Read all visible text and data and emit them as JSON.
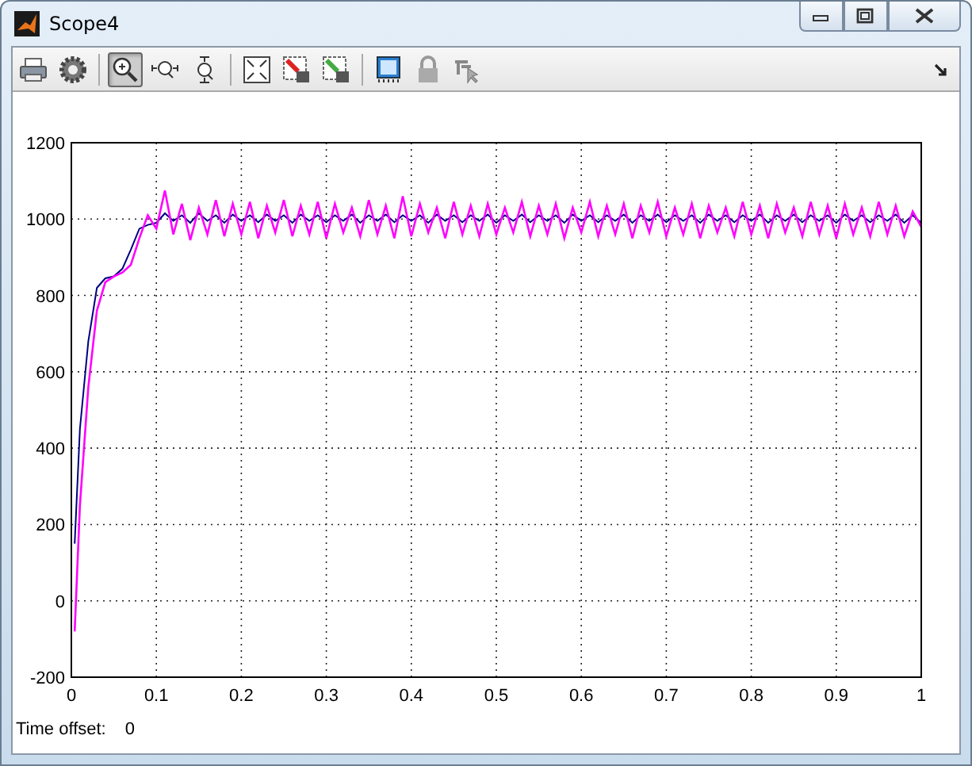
{
  "window": {
    "title": "Scope4"
  },
  "toolbar": [
    {
      "kind": "print",
      "selected": false
    },
    {
      "kind": "parameters",
      "selected": false
    },
    {
      "kind": "separator"
    },
    {
      "kind": "zoom",
      "selected": true
    },
    {
      "kind": "zoom-x",
      "selected": false
    },
    {
      "kind": "zoom-y",
      "selected": false
    },
    {
      "kind": "separator"
    },
    {
      "kind": "autoscale",
      "selected": false
    },
    {
      "kind": "save-axes",
      "selected": false
    },
    {
      "kind": "restore-axes",
      "selected": false
    },
    {
      "kind": "separator"
    },
    {
      "kind": "float",
      "selected": false
    },
    {
      "kind": "lock",
      "selected": false
    },
    {
      "kind": "signal-select",
      "selected": false
    }
  ],
  "plot": {
    "chart_data": {
      "type": "line",
      "grid": true,
      "x": [
        0.004,
        0.01,
        0.02,
        0.03,
        0.04,
        0.05,
        0.06,
        0.07,
        0.08,
        0.09,
        0.1,
        0.11,
        0.12,
        0.13,
        0.14,
        0.15,
        0.16,
        0.17,
        0.18,
        0.19,
        0.2,
        0.21,
        0.22,
        0.23,
        0.24,
        0.25,
        0.26,
        0.27,
        0.28,
        0.29,
        0.3,
        0.31,
        0.32,
        0.33,
        0.34,
        0.35,
        0.36,
        0.37,
        0.38,
        0.39,
        0.4,
        0.41,
        0.42,
        0.43,
        0.44,
        0.45,
        0.46,
        0.47,
        0.48,
        0.49,
        0.5,
        0.51,
        0.52,
        0.53,
        0.54,
        0.55,
        0.56,
        0.57,
        0.58,
        0.59,
        0.6,
        0.61,
        0.62,
        0.63,
        0.64,
        0.65,
        0.66,
        0.67,
        0.68,
        0.69,
        0.7,
        0.71,
        0.72,
        0.73,
        0.74,
        0.75,
        0.76,
        0.77,
        0.78,
        0.79,
        0.8,
        0.81,
        0.82,
        0.83,
        0.84,
        0.85,
        0.86,
        0.87,
        0.88,
        0.89,
        0.9,
        0.91,
        0.92,
        0.93,
        0.94,
        0.95,
        0.96,
        0.97,
        0.98,
        0.99,
        1
      ],
      "series": [
        {
          "color": "#000080",
          "values": [
            150,
            450,
            680,
            820,
            845,
            850,
            870,
            920,
            975,
            985,
            990,
            1015,
            995,
            1010,
            990,
            1015,
            995,
            1010,
            990,
            1012,
            995,
            1010,
            992,
            1012,
            995,
            1010,
            990,
            1012,
            995,
            1010,
            992,
            1010,
            995,
            1012,
            990,
            1010,
            995,
            1012,
            992,
            1010,
            995,
            1010,
            990,
            1012,
            995,
            1010,
            992,
            1010,
            995,
            1012,
            990,
            1010,
            995,
            1012,
            992,
            1010,
            995,
            1010,
            990,
            1012,
            995,
            1010,
            992,
            1010,
            995,
            1012,
            990,
            1010,
            995,
            1012,
            992,
            1010,
            995,
            1010,
            990,
            1012,
            995,
            1010,
            992,
            1010,
            995,
            1012,
            990,
            1010,
            995,
            1012,
            992,
            1010,
            995,
            1010,
            990,
            1012,
            995,
            1010,
            992,
            1010,
            995,
            1012,
            990,
            1010,
            990
          ]
        },
        {
          "color": "#ff00ff",
          "values": [
            -80,
            250,
            560,
            760,
            835,
            850,
            860,
            880,
            950,
            1010,
            975,
            1075,
            960,
            1040,
            945,
            1030,
            960,
            1050,
            955,
            1040,
            960,
            1045,
            950,
            1035,
            965,
            1050,
            955,
            1035,
            960,
            1045,
            950,
            1040,
            965,
            1030,
            955,
            1050,
            960,
            1035,
            950,
            1060,
            955,
            1040,
            965,
            1030,
            950,
            1045,
            960,
            1035,
            955,
            1040,
            960,
            1030,
            965,
            1045,
            955,
            1035,
            960,
            1040,
            950,
            1030,
            965,
            1045,
            955,
            1035,
            960,
            1040,
            950,
            1035,
            965,
            1045,
            955,
            1030,
            960,
            1040,
            950,
            1035,
            965,
            1030,
            955,
            1045,
            960,
            1035,
            950,
            1040,
            965,
            1030,
            955,
            1045,
            960,
            1035,
            950,
            1040,
            960,
            1030,
            955,
            1045,
            960,
            1035,
            955,
            1020,
            980
          ]
        }
      ],
      "xlim": [
        0,
        1
      ],
      "ylim": [
        -200,
        1200
      ],
      "xticks": [
        0,
        0.1,
        0.2,
        0.3,
        0.4,
        0.5,
        0.6,
        0.7,
        0.8,
        0.9,
        1
      ],
      "yticks": [
        -200,
        0,
        200,
        400,
        600,
        800,
        1000,
        1200
      ]
    }
  },
  "status": {
    "label": "Time offset:",
    "value": "0"
  }
}
